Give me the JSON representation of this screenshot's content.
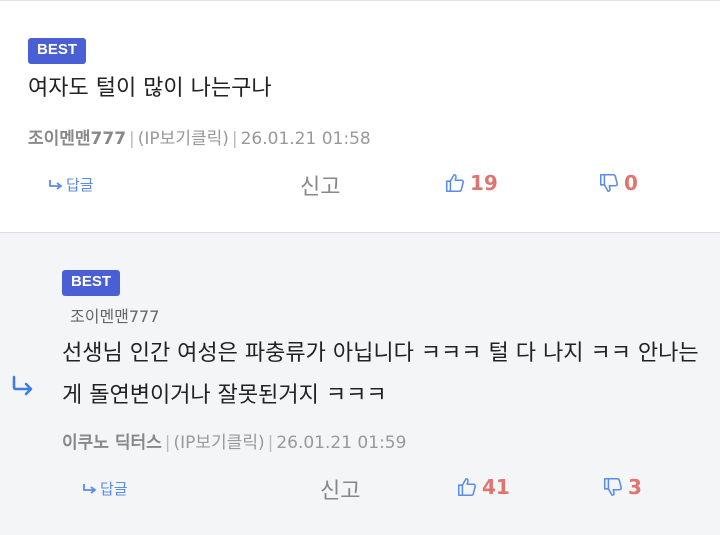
{
  "comments": [
    {
      "badge": "BEST",
      "text": "여자도 털이 많이 나는구나",
      "author": "조이멘맨777",
      "ip": "(IP보기클릭)",
      "date": "26.01.21 01:58",
      "reply_label": "답글",
      "report_label": "신고",
      "upvotes": "19",
      "downvotes": "0"
    },
    {
      "badge": "BEST",
      "reply_to": "조이멘맨777",
      "text": "선생님 인간 여성은 파충류가 아닙니다 ㅋㅋㅋ 털 다 나지 ㅋㅋ 안나는게 돌연변이거나 잘못된거지 ㅋㅋㅋ",
      "author": "이쿠노 딕터스",
      "ip": "(IP보기클릭)",
      "date": "26.01.21 01:59",
      "reply_label": "답글",
      "report_label": "신고",
      "upvotes": "41",
      "downvotes": "3"
    }
  ],
  "colors": {
    "badge": "#4a5fd3",
    "reply_link": "#5b8ce8",
    "vote_count": "#e07470",
    "thumb_icon": "#5b8ce8"
  },
  "icons": [
    "reply-arrow-icon",
    "thumbs-up-icon",
    "thumbs-down-icon",
    "nested-reply-arrow-icon"
  ]
}
